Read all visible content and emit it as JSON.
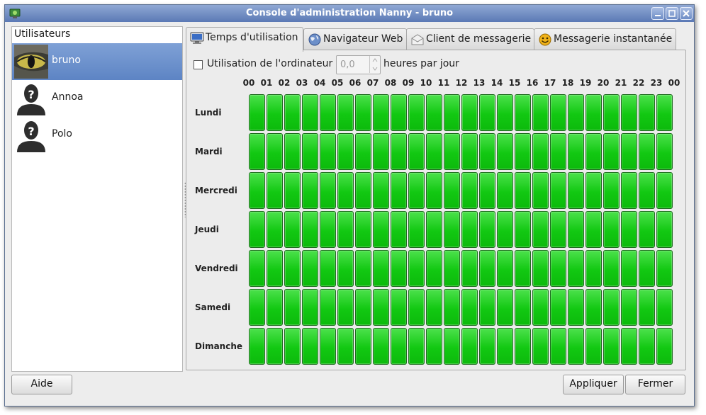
{
  "window": {
    "title": "Console d'administration Nanny - bruno"
  },
  "users": {
    "header": "Utilisateurs",
    "items": [
      {
        "name": "bruno",
        "selected": true
      },
      {
        "name": "Annoa",
        "selected": false
      },
      {
        "name": "Polo",
        "selected": false
      }
    ]
  },
  "tabs": [
    {
      "label": "Temps d'utilisation",
      "icon": "computer-icon",
      "active": true
    },
    {
      "label": "Navigateur Web",
      "icon": "globe-icon",
      "active": false
    },
    {
      "label": "Client de messagerie",
      "icon": "mail-icon",
      "active": false
    },
    {
      "label": "Messagerie instantanée",
      "icon": "smiley-icon",
      "active": false
    }
  ],
  "usage": {
    "checkbox_label": "Utilisation de l'ordinateur",
    "checked": false,
    "hours_value": "0,0",
    "hours_unit": "heures par jour"
  },
  "schedule": {
    "hours": [
      "00",
      "01",
      "02",
      "03",
      "04",
      "05",
      "06",
      "07",
      "08",
      "09",
      "10",
      "11",
      "12",
      "13",
      "14",
      "15",
      "16",
      "17",
      "18",
      "19",
      "20",
      "21",
      "22",
      "23",
      "00"
    ],
    "days": [
      "Lundi",
      "Mardi",
      "Mercredi",
      "Jeudi",
      "Vendredi",
      "Samedi",
      "Dimanche"
    ],
    "cell_color": "#1ec81e"
  },
  "buttons": {
    "help": "Aide",
    "apply": "Appliquer",
    "close": "Fermer"
  }
}
